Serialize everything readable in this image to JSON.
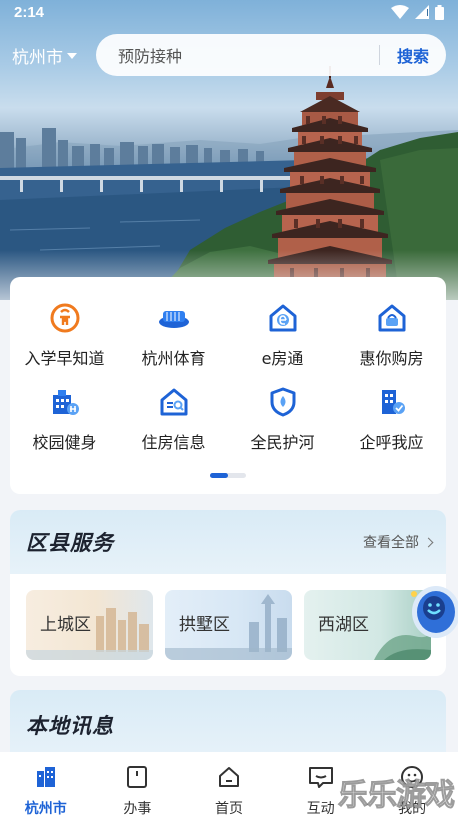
{
  "status_bar": {
    "time": "2:14"
  },
  "header": {
    "city": "杭州市",
    "search_placeholder": "预防接种",
    "search_button": "搜索"
  },
  "services": [
    {
      "label": "入学早知道",
      "icon": "school-enrollment-icon"
    },
    {
      "label": "杭州体育",
      "icon": "stadium-icon"
    },
    {
      "label": "e房通",
      "icon": "house-e-icon"
    },
    {
      "label": "惠你购房",
      "icon": "house-basket-icon"
    },
    {
      "label": "校园健身",
      "icon": "campus-fitness-icon"
    },
    {
      "label": "住房信息",
      "icon": "house-search-icon"
    },
    {
      "label": "全民护河",
      "icon": "river-shield-icon"
    },
    {
      "label": "企呼我应",
      "icon": "enterprise-check-icon"
    }
  ],
  "district": {
    "title": "区县服务",
    "view_all": "查看全部",
    "items": [
      "上城区",
      "拱墅区",
      "西湖区"
    ]
  },
  "news": {
    "title": "本地讯息"
  },
  "bottom_nav": [
    {
      "label": "杭州市",
      "icon": "city-buildings-icon",
      "active": true
    },
    {
      "label": "办事",
      "icon": "document-icon",
      "active": false
    },
    {
      "label": "首页",
      "icon": "home-icon",
      "active": false
    },
    {
      "label": "互动",
      "icon": "chat-icon",
      "active": false
    },
    {
      "label": "我的",
      "icon": "profile-icon",
      "active": false
    }
  ],
  "watermark": "乐乐游戏",
  "colors": {
    "accent": "#1e63d6",
    "orange": "#f07a1e"
  }
}
